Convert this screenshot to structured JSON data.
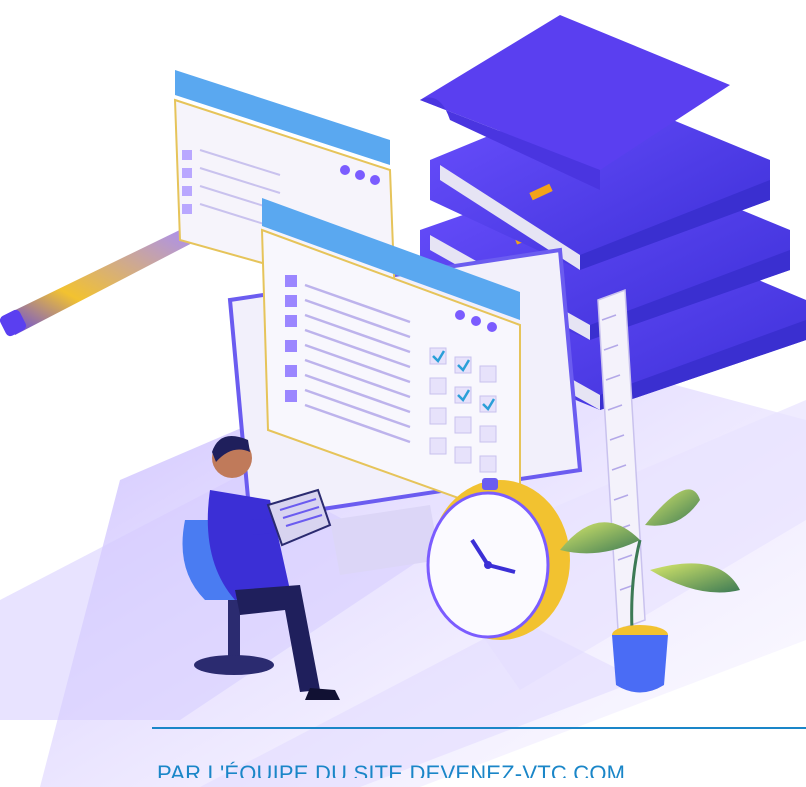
{
  "byline": "PAR L'ÉQUIPE DU SITE DEVENEZ-VTC.COM",
  "colors": {
    "accent": "#1a86c8",
    "purple": "#5a3ff0",
    "violet": "#7b5cff",
    "lavender": "#efeaff",
    "yellow": "#f2c230"
  }
}
